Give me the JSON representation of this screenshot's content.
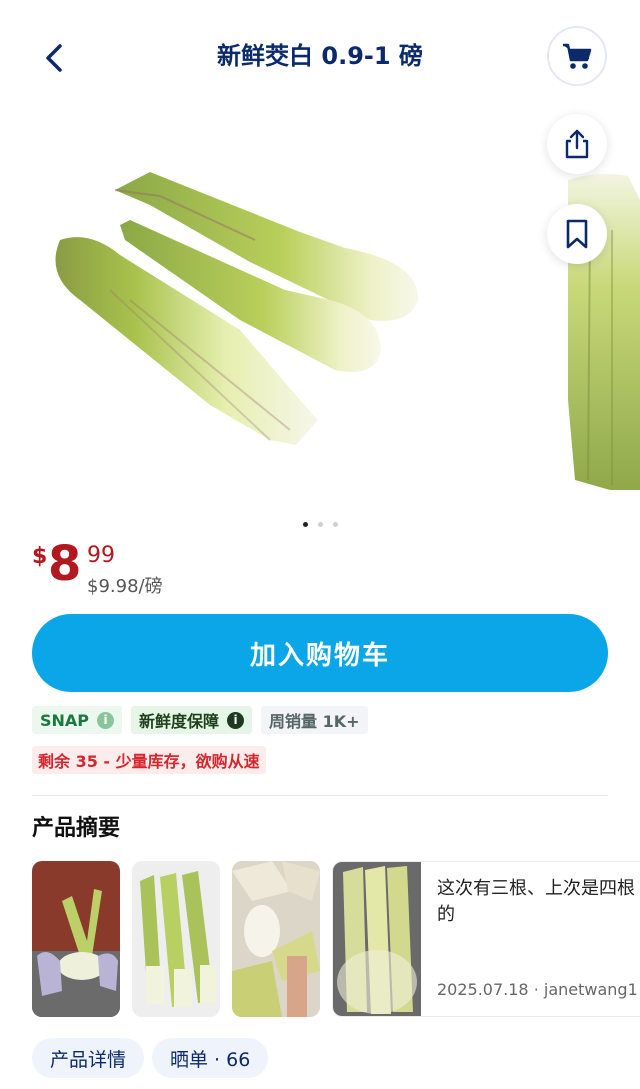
{
  "header": {
    "title": "新鲜茭白 0.9-1 磅",
    "back_icon": "chevron-left-icon",
    "cart_icon": "shopping-cart-icon"
  },
  "actions": {
    "share_icon": "share-icon",
    "bookmark_icon": "bookmark-icon"
  },
  "carousel": {
    "slide_count": 3,
    "active_index": 0
  },
  "price": {
    "currency": "$",
    "integer": "8",
    "cents": "99",
    "unit_price": "$9.98/磅"
  },
  "add_to_cart": {
    "label": "加入购物车"
  },
  "badges": {
    "snap": "SNAP",
    "fresh": "新鲜度保障",
    "sales": "周销量 1K+"
  },
  "stock_notice": "剩余 35 - 少量库存，欲购从速",
  "summary": {
    "title": "产品摘要",
    "review_text": "这次有三根、上次是四根的",
    "review_meta": "2025.07.18 · janetwang1"
  },
  "tabs": [
    {
      "label": "产品详情"
    },
    {
      "label": "晒单 · 66"
    }
  ],
  "colors": {
    "brand_blue": "#0aa6e8",
    "title_navy": "#0b2a6b",
    "price_red": "#b11820",
    "snap_green": "#1a7a3c",
    "stock_red": "#d6262d"
  }
}
